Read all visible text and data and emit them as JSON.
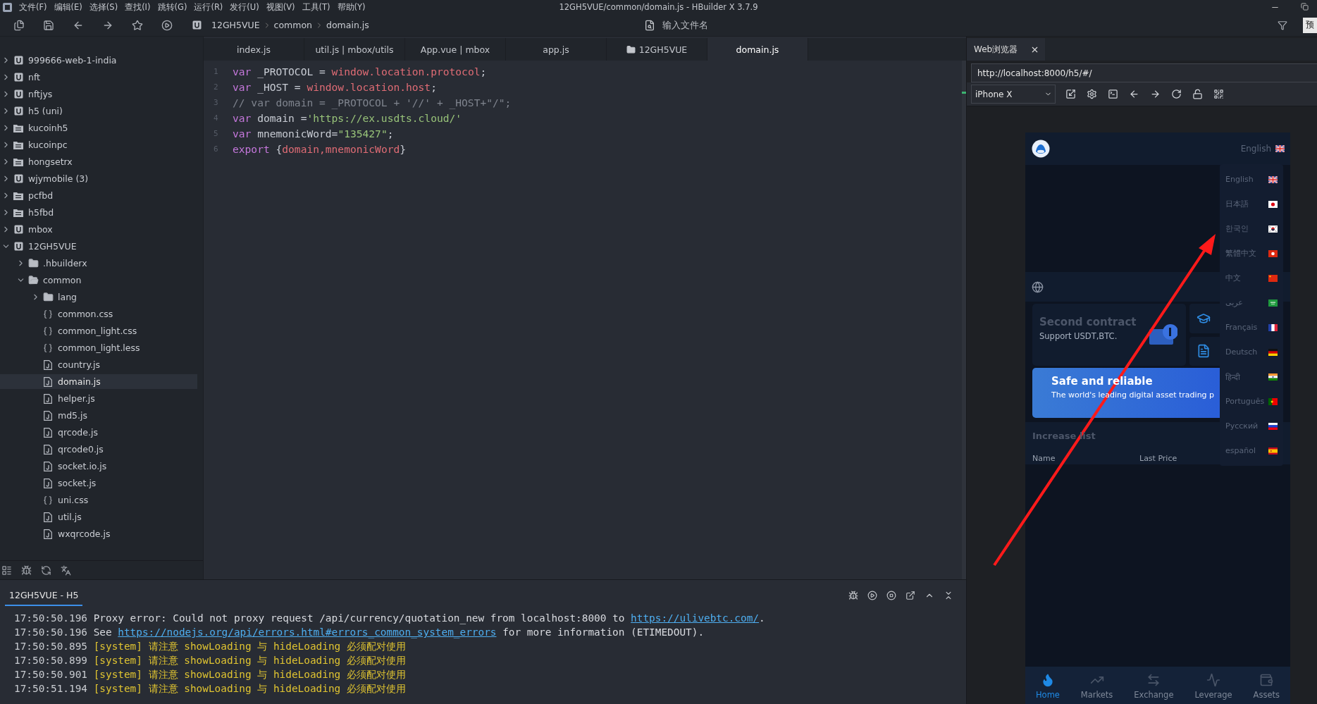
{
  "title_bar": {
    "menus": [
      "文件(F)",
      "编辑(E)",
      "选择(S)",
      "查找(I)",
      "跳转(G)",
      "运行(R)",
      "发行(U)",
      "视图(V)",
      "工具(T)",
      "帮助(Y)"
    ],
    "title": "12GH5VUE/common/domain.js - HBuilder X 3.7.9"
  },
  "toolbar": {
    "breadcrumb": [
      "12GH5VUE",
      "common",
      "domain.js"
    ],
    "search": {
      "placeholder": "输入文件名"
    },
    "preview_button": "预"
  },
  "sidebar": {
    "tree": [
      {
        "label": "999666-web-1-india",
        "kind": "project",
        "expanded": false,
        "selected": false
      },
      {
        "label": "nft",
        "kind": "project",
        "expanded": false,
        "selected": false
      },
      {
        "label": "nftjys",
        "kind": "project",
        "expanded": false,
        "selected": false
      },
      {
        "label": "h5 (uni)",
        "kind": "project",
        "expanded": false,
        "selected": false
      },
      {
        "label": "kucoinh5",
        "kind": "stack",
        "expanded": false,
        "selected": false
      },
      {
        "label": "kucoinpc",
        "kind": "stack",
        "expanded": false,
        "selected": false
      },
      {
        "label": "hongsetrx",
        "kind": "stack",
        "expanded": false,
        "selected": false
      },
      {
        "label": "wjymobile (3)",
        "kind": "project",
        "expanded": false,
        "selected": false
      },
      {
        "label": "pcfbd",
        "kind": "stack",
        "expanded": false,
        "selected": false
      },
      {
        "label": "h5fbd",
        "kind": "stack",
        "expanded": false,
        "selected": false
      },
      {
        "label": "mbox",
        "kind": "project",
        "expanded": false,
        "selected": false
      },
      {
        "label": "12GH5VUE",
        "kind": "project",
        "expanded": true,
        "selected": false,
        "children": [
          {
            "label": ".hbuilderx",
            "kind": "folder",
            "expanded": false,
            "selected": false
          },
          {
            "label": "common",
            "kind": "folder",
            "expanded": true,
            "selected": false,
            "children": [
              {
                "label": "lang",
                "kind": "folder",
                "expanded": false,
                "selected": false
              },
              {
                "label": "common.css",
                "kind": "style",
                "selected": false
              },
              {
                "label": "common_light.css",
                "kind": "style",
                "selected": false
              },
              {
                "label": "common_light.less",
                "kind": "style",
                "selected": false
              },
              {
                "label": "country.js",
                "kind": "script",
                "selected": false
              },
              {
                "label": "domain.js",
                "kind": "script",
                "selected": true
              },
              {
                "label": "helper.js",
                "kind": "script",
                "selected": false
              },
              {
                "label": "md5.js",
                "kind": "script",
                "selected": false
              },
              {
                "label": "qrcode.js",
                "kind": "script",
                "selected": false
              },
              {
                "label": "qrcode0.js",
                "kind": "script",
                "selected": false
              },
              {
                "label": "socket.io.js",
                "kind": "script",
                "selected": false
              },
              {
                "label": "socket.js",
                "kind": "script",
                "selected": false
              },
              {
                "label": "uni.css",
                "kind": "style",
                "selected": false
              },
              {
                "label": "util.js",
                "kind": "script",
                "selected": false
              },
              {
                "label": "wxqrcode.js",
                "kind": "script",
                "selected": false
              }
            ]
          }
        ]
      }
    ]
  },
  "editor": {
    "tabs": [
      {
        "label": "index.js",
        "kind": "file",
        "selected": false
      },
      {
        "label": "util.js | mbox/utils",
        "kind": "file",
        "selected": false
      },
      {
        "label": "App.vue | mbox",
        "kind": "file",
        "selected": false
      },
      {
        "label": "app.js",
        "kind": "file",
        "selected": false
      },
      {
        "label": "12GH5VUE",
        "kind": "folder",
        "selected": false
      },
      {
        "label": "domain.js",
        "kind": "file",
        "selected": true
      }
    ],
    "lines": [
      {
        "number": "1",
        "tokens": [
          {
            "text": "var",
            "kind": "keyword"
          },
          {
            "text": " _PROTOCOL = ",
            "kind": "plain"
          },
          {
            "text": "window.location.protocol",
            "kind": "ident"
          },
          {
            "text": ";",
            "kind": "plain"
          }
        ]
      },
      {
        "number": "2",
        "tokens": [
          {
            "text": "var",
            "kind": "keyword"
          },
          {
            "text": " _HOST = ",
            "kind": "plain"
          },
          {
            "text": "window.location.host",
            "kind": "ident"
          },
          {
            "text": ";",
            "kind": "plain"
          }
        ]
      },
      {
        "number": "3",
        "tokens": [
          {
            "text": "// var domain = _PROTOCOL + '//' + _HOST+\"/\";",
            "kind": "comment"
          }
        ]
      },
      {
        "number": "4",
        "tokens": [
          {
            "text": "var",
            "kind": "keyword"
          },
          {
            "text": " domain =",
            "kind": "plain"
          },
          {
            "text": "'https://ex.usdts.cloud/'",
            "kind": "string"
          }
        ]
      },
      {
        "number": "5",
        "tokens": [
          {
            "text": "var",
            "kind": "keyword"
          },
          {
            "text": " mnemonicWord=",
            "kind": "plain"
          },
          {
            "text": "\"135427\"",
            "kind": "string"
          },
          {
            "text": ";",
            "kind": "plain"
          }
        ]
      },
      {
        "number": "6",
        "tokens": [
          {
            "text": "export",
            "kind": "keyword"
          },
          {
            "text": " {",
            "kind": "plain"
          },
          {
            "text": "domain,mnemonicWord",
            "kind": "ident"
          },
          {
            "text": "}",
            "kind": "plain"
          }
        ]
      }
    ]
  },
  "browser": {
    "tab": "Web浏览器",
    "url": "http://localhost:8000/h5/#/",
    "device": "iPhone X",
    "phone": {
      "language": {
        "label": "English",
        "kind": "gb"
      },
      "languages": [
        {
          "label": "English",
          "kind": "gb"
        },
        {
          "label": "日本語",
          "kind": "jp"
        },
        {
          "label": "한국인",
          "kind": "kr"
        },
        {
          "label": "繁體中文",
          "kind": "hk"
        },
        {
          "label": "中文",
          "kind": "cn"
        },
        {
          "label": "عربى",
          "kind": "sa"
        },
        {
          "label": "Français",
          "kind": "fr"
        },
        {
          "label": "Deutsch",
          "kind": "de"
        },
        {
          "label": "हिन्दी",
          "kind": "in"
        },
        {
          "label": "Português",
          "kind": "pt"
        },
        {
          "label": "Русский",
          "kind": "ru"
        },
        {
          "label": "español",
          "kind": "es"
        }
      ],
      "contract_card": {
        "title": "Second contract",
        "subtitle": "Support USDT,BTC."
      },
      "banner": {
        "title": "Safe and reliable",
        "subtitle": "The world's leading digital asset trading p"
      },
      "list": {
        "title": "Increase list",
        "columns": [
          "Name",
          "Last Price"
        ]
      },
      "nav": [
        {
          "label": "Home",
          "kind": "home",
          "selected": true
        },
        {
          "label": "Markets",
          "kind": "markets",
          "selected": false
        },
        {
          "label": "Exchange",
          "kind": "exchange",
          "selected": false
        },
        {
          "label": "Leverage",
          "kind": "leverage",
          "selected": false
        },
        {
          "label": "Assets",
          "kind": "assets",
          "selected": false
        }
      ]
    }
  },
  "console": {
    "tab": {
      "label": "12GH5VUE - H5",
      "selected": true
    },
    "lines": [
      {
        "time": "17:50:50.196",
        "kind": "output",
        "parts": [
          {
            "text": "Proxy error: Could not proxy request /api/currency/quotation_new from localhost:8000 to ",
            "kind": "text"
          },
          {
            "text": "https://ulivebtc.com/",
            "kind": "link"
          },
          {
            "text": ".",
            "kind": "text"
          }
        ]
      },
      {
        "time": "17:50:50.196",
        "kind": "output",
        "parts": [
          {
            "text": "See ",
            "kind": "text"
          },
          {
            "text": "https://nodejs.org/api/errors.html#errors_common_system_errors",
            "kind": "link"
          },
          {
            "text": " for more information (ETIMEDOUT).",
            "kind": "text"
          }
        ]
      },
      {
        "time": "17:50:50.895",
        "kind": "system",
        "parts": [
          {
            "text": "[system] 请注意 showLoading 与 hideLoading 必须配对使用",
            "kind": "text"
          }
        ]
      },
      {
        "time": "17:50:50.899",
        "kind": "system",
        "parts": [
          {
            "text": "[system] 请注意 showLoading 与 hideLoading 必须配对使用",
            "kind": "text"
          }
        ]
      },
      {
        "time": "17:50:50.901",
        "kind": "system",
        "parts": [
          {
            "text": "[system] 请注意 showLoading 与 hideLoading 必须配对使用",
            "kind": "text"
          }
        ]
      },
      {
        "time": "17:50:51.194",
        "kind": "system",
        "parts": [
          {
            "text": "[system] 请注意 showLoading 与 hideLoading 必须配对使用",
            "kind": "text"
          }
        ]
      }
    ]
  }
}
